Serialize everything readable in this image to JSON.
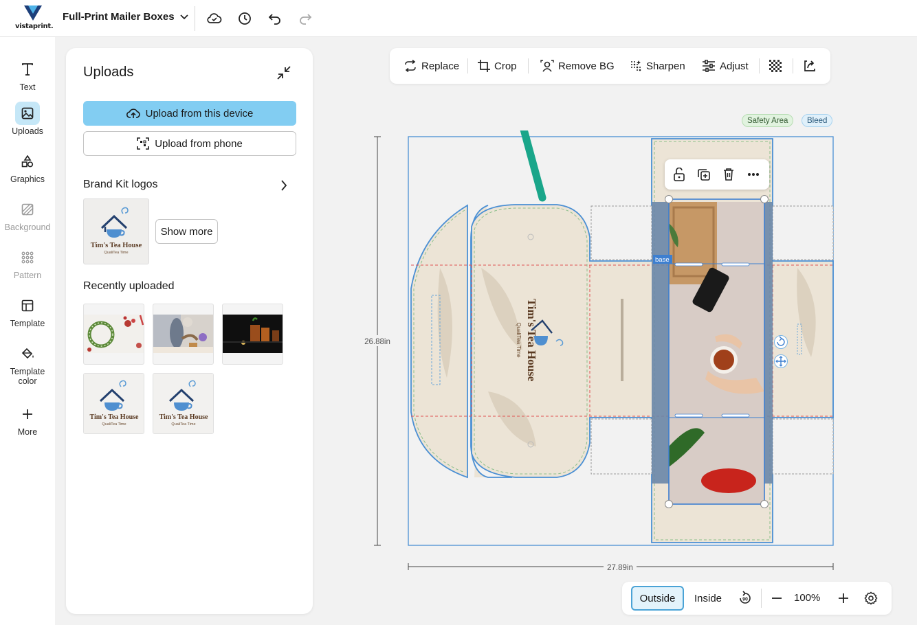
{
  "header": {
    "logo_text": "vistaprint.",
    "product_title": "Full-Print Mailer Boxes"
  },
  "rail": {
    "items": [
      {
        "label": "Text",
        "icon": "text-icon"
      },
      {
        "label": "Uploads",
        "icon": "image-icon"
      },
      {
        "label": "Graphics",
        "icon": "shapes-icon"
      },
      {
        "label": "Background",
        "icon": "background-icon"
      },
      {
        "label": "Pattern",
        "icon": "pattern-icon"
      },
      {
        "label": "Template",
        "icon": "template-icon"
      },
      {
        "label": "Template",
        "label2": "color",
        "icon": "paint-bucket-icon"
      },
      {
        "label": "More",
        "icon": "plus-icon"
      }
    ]
  },
  "panel": {
    "title": "Uploads",
    "upload_device": "Upload from this device",
    "upload_phone": "Upload from phone",
    "brand_kit_heading": "Brand Kit logos",
    "show_more": "Show more",
    "recent_heading": "Recently uploaded",
    "logo_name": "Tim's Tea House",
    "logo_tagline": "QualiTea Time"
  },
  "toolbar": {
    "replace": "Replace",
    "crop": "Crop",
    "remove_bg": "Remove BG",
    "sharpen": "Sharpen",
    "adjust": "Adjust"
  },
  "legend": {
    "safety_area": "Safety Area",
    "bleed": "Bleed"
  },
  "canvas": {
    "height_label": "26.88in",
    "width_label": "27.89in",
    "base_tag": "base",
    "box_brand": "Tim's Tea House",
    "box_tagline": "QualiTea Time"
  },
  "bottom": {
    "outside": "Outside",
    "inside": "Inside",
    "zoom": "100%"
  },
  "colors": {
    "accent_blue": "#82cdf2",
    "die_line": "#4a8fd4",
    "safety_green": "#8bbf8b",
    "bleed_red": "#e05252",
    "box_fill": "#ece4d6",
    "annotation_arrow": "#1aa68a"
  }
}
